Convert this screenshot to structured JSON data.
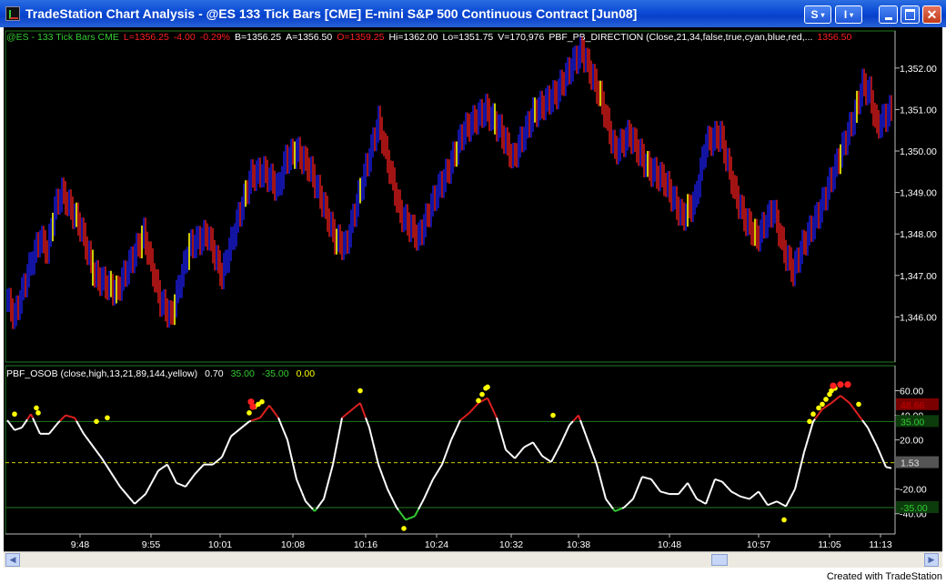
{
  "window": {
    "title": "TradeStation Chart Analysis - @ES  133 Tick Bars [CME] E-mini S&P 500 Continuous Contract [Jun08]",
    "buttons": {
      "style_label": "S",
      "insert_label": "I",
      "minimize": "minimize",
      "maximize": "maximize",
      "close": "close"
    }
  },
  "price_header": [
    {
      "text": "@ES - 133 Tick Bars  CME",
      "color": "#33cc33"
    },
    {
      "text": "L=1356.25",
      "color": "#ff2020"
    },
    {
      "text": "-4.00",
      "color": "#ff2020"
    },
    {
      "text": "-0.29%",
      "color": "#ff2020"
    },
    {
      "text": "B=1356.25",
      "color": "#ffffff"
    },
    {
      "text": "A=1356.50",
      "color": "#ffffff"
    },
    {
      "text": "O=1359.25",
      "color": "#ff2020"
    },
    {
      "text": "Hi=1362.00",
      "color": "#ffffff"
    },
    {
      "text": "Lo=1351.75",
      "color": "#ffffff"
    },
    {
      "text": "V=170,976",
      "color": "#ffffff"
    },
    {
      "text": "PBF_PB_DIRECTION (Close,21,34,false,true,cyan,blue,red,...",
      "color": "#ffffff"
    },
    {
      "text": "1356.50",
      "color": "#ff2020"
    }
  ],
  "price_axis": {
    "labels": [
      "1,352.00",
      "1,351.00",
      "1,350.00",
      "1,349.00",
      "1,348.00",
      "1,347.00",
      "1,346.00"
    ]
  },
  "indicator_header": [
    {
      "text": "PBF_OSOB (close,high,13,21,89,144,yellow)",
      "color": "#ffffff"
    },
    {
      "text": "0.70",
      "color": "#ffffff"
    },
    {
      "text": "35.00",
      "color": "#33cc33"
    },
    {
      "text": "-35.00",
      "color": "#33cc33"
    },
    {
      "text": "0.00",
      "color": "#ffff00"
    }
  ],
  "indicator_axis": {
    "labels": [
      "60.00",
      "40.00",
      "20.00",
      "-20.00",
      "-40.00"
    ]
  },
  "indicator_tags": [
    {
      "text": "48.66",
      "color": "#cc0000",
      "fill": "#7a0000"
    },
    {
      "text": "35.00",
      "color": "#33cc33",
      "fill": "#0c3c0c"
    },
    {
      "text": "1.53",
      "color": "#e0e0e0",
      "fill": "#555555"
    },
    {
      "text": "-35.00",
      "color": "#33cc33",
      "fill": "#0c3c0c"
    }
  ],
  "time_axis": {
    "labels": [
      "9:48",
      "9:55",
      "10:01",
      "10:08",
      "10:16",
      "10:24",
      "10:32",
      "10:38",
      "10:48",
      "10:57",
      "11:05",
      "11:13"
    ]
  },
  "scrollbar": {
    "left_arrow": "◀",
    "right_arrow": "▶"
  },
  "footer": {
    "credit": "Created with TradeStation"
  },
  "colors": {
    "background": "#000000",
    "up_bar": "#1a1acc",
    "down_bar": "#cc1a1a",
    "neutral_bar": "#ffff00",
    "oscillator": "#ffffff",
    "overbought_line": "#1f7a1f",
    "zero_line": "#ffff00"
  },
  "chart_data": {
    "type": "bar",
    "price_range": [
      1345.0,
      1352.5
    ],
    "indicator_range": [
      -55,
      70
    ],
    "overbought": 35.0,
    "oversold": -35.0,
    "last_oscillator": 1.53,
    "price_anchors": [
      [
        0,
        1346.4
      ],
      [
        4,
        1346.0
      ],
      [
        13,
        1347.3
      ],
      [
        18,
        1347.9
      ],
      [
        22,
        1347.6
      ],
      [
        26,
        1348.6
      ],
      [
        30,
        1349.0
      ],
      [
        40,
        1348.2
      ],
      [
        48,
        1347.0
      ],
      [
        60,
        1346.6
      ],
      [
        75,
        1348.0
      ],
      [
        84,
        1346.4
      ],
      [
        90,
        1346.0
      ],
      [
        100,
        1347.7
      ],
      [
        110,
        1348.0
      ],
      [
        118,
        1347.0
      ],
      [
        127,
        1348.4
      ],
      [
        134,
        1349.4
      ],
      [
        141,
        1349.5
      ],
      [
        149,
        1349.1
      ],
      [
        153,
        1349.8
      ],
      [
        159,
        1350.0
      ],
      [
        166,
        1349.6
      ],
      [
        173,
        1348.8
      ],
      [
        180,
        1347.9
      ],
      [
        186,
        1347.7
      ],
      [
        193,
        1348.9
      ],
      [
        204,
        1350.7
      ],
      [
        216,
        1348.5
      ],
      [
        226,
        1347.9
      ],
      [
        236,
        1349.0
      ],
      [
        242,
        1349.5
      ],
      [
        251,
        1350.5
      ],
      [
        263,
        1351.0
      ],
      [
        271,
        1350.5
      ],
      [
        278,
        1349.8
      ],
      [
        289,
        1350.9
      ],
      [
        302,
        1351.4
      ],
      [
        312,
        1352.2
      ],
      [
        316,
        1352.4
      ],
      [
        326,
        1351.3
      ],
      [
        334,
        1350.0
      ],
      [
        342,
        1350.4
      ],
      [
        352,
        1349.6
      ],
      [
        361,
        1349.3
      ],
      [
        371,
        1348.4
      ],
      [
        378,
        1348.8
      ],
      [
        384,
        1350.2
      ],
      [
        392,
        1350.4
      ],
      [
        400,
        1349.0
      ],
      [
        405,
        1348.4
      ],
      [
        412,
        1347.9
      ],
      [
        421,
        1348.6
      ],
      [
        427,
        1347.6
      ],
      [
        432,
        1347.1
      ],
      [
        437,
        1347.7
      ],
      [
        447,
        1348.6
      ],
      [
        456,
        1349.7
      ],
      [
        466,
        1350.9
      ],
      [
        470,
        1351.6
      ],
      [
        474,
        1351.4
      ],
      [
        478,
        1350.6
      ],
      [
        486,
        1351.0
      ]
    ],
    "yellow_bars": [
      25,
      38,
      47,
      57,
      60,
      74,
      92,
      100,
      131,
      158,
      181,
      194,
      247,
      268,
      290,
      326,
      352,
      374,
      411,
      458,
      467
    ],
    "oscillator_anchors": [
      [
        0,
        36
      ],
      [
        4,
        28
      ],
      [
        8,
        30
      ],
      [
        13,
        41
      ],
      [
        18,
        25
      ],
      [
        23,
        25
      ],
      [
        28,
        34
      ],
      [
        32,
        40
      ],
      [
        37,
        38
      ],
      [
        42,
        25
      ],
      [
        52,
        5
      ],
      [
        62,
        -18
      ],
      [
        70,
        -32
      ],
      [
        76,
        -24
      ],
      [
        83,
        -5
      ],
      [
        88,
        0
      ],
      [
        93,
        -15
      ],
      [
        98,
        -18
      ],
      [
        103,
        -8
      ],
      [
        108,
        0
      ],
      [
        113,
        0
      ],
      [
        118,
        6
      ],
      [
        123,
        23
      ],
      [
        133,
        35
      ],
      [
        139,
        38
      ],
      [
        144,
        48
      ],
      [
        149,
        38
      ],
      [
        154,
        20
      ],
      [
        159,
        -12
      ],
      [
        164,
        -30
      ],
      [
        169,
        -38
      ],
      [
        174,
        -28
      ],
      [
        179,
        0
      ],
      [
        184,
        38
      ],
      [
        194,
        50
      ],
      [
        199,
        30
      ],
      [
        204,
        0
      ],
      [
        209,
        -20
      ],
      [
        214,
        -35
      ],
      [
        219,
        -45
      ],
      [
        224,
        -42
      ],
      [
        229,
        -28
      ],
      [
        234,
        -12
      ],
      [
        239,
        0
      ],
      [
        244,
        20
      ],
      [
        249,
        36
      ],
      [
        254,
        42
      ],
      [
        259,
        50
      ],
      [
        264,
        54
      ],
      [
        269,
        38
      ],
      [
        274,
        12
      ],
      [
        279,
        5
      ],
      [
        284,
        14
      ],
      [
        289,
        18
      ],
      [
        294,
        7
      ],
      [
        299,
        2
      ],
      [
        304,
        16
      ],
      [
        309,
        32
      ],
      [
        314,
        40
      ],
      [
        319,
        20
      ],
      [
        324,
        0
      ],
      [
        329,
        -28
      ],
      [
        334,
        -38
      ],
      [
        339,
        -35
      ],
      [
        344,
        -28
      ],
      [
        349,
        -10
      ],
      [
        354,
        -12
      ],
      [
        359,
        -22
      ],
      [
        364,
        -24
      ],
      [
        369,
        -24
      ],
      [
        374,
        -15
      ],
      [
        379,
        -28
      ],
      [
        384,
        -32
      ],
      [
        389,
        -12
      ],
      [
        393,
        -14
      ],
      [
        398,
        -22
      ],
      [
        403,
        -26
      ],
      [
        408,
        -28
      ],
      [
        413,
        -22
      ],
      [
        418,
        -33
      ],
      [
        423,
        -30
      ],
      [
        428,
        -34
      ],
      [
        433,
        -20
      ],
      [
        438,
        10
      ],
      [
        443,
        35
      ],
      [
        448,
        45
      ],
      [
        453,
        50
      ],
      [
        458,
        56
      ],
      [
        463,
        50
      ],
      [
        468,
        40
      ],
      [
        473,
        30
      ],
      [
        478,
        15
      ],
      [
        483,
        -2
      ],
      [
        486,
        -3
      ]
    ],
    "osc_dot_bars": [
      [
        4,
        41,
        "#ffff00"
      ],
      [
        16,
        46,
        "#ffff00"
      ],
      [
        17,
        42,
        "#ffff00"
      ],
      [
        49,
        35,
        "#ffff00"
      ],
      [
        55,
        38,
        "#ffff00"
      ],
      [
        133,
        42,
        "#ffff00"
      ],
      [
        136,
        47,
        "#ffff00"
      ],
      [
        138,
        49,
        "#ffff00"
      ],
      [
        140,
        51,
        "#ffff00"
      ],
      [
        134,
        51,
        "#ff2020"
      ],
      [
        135,
        47,
        "#ff2020"
      ],
      [
        194,
        60,
        "#ffff00"
      ],
      [
        218,
        -52,
        "#ffff00"
      ],
      [
        259,
        52,
        "#ffff00"
      ],
      [
        261,
        57,
        "#ffff00"
      ],
      [
        263,
        62,
        "#ffff00"
      ],
      [
        264,
        63,
        "#ffff00"
      ],
      [
        300,
        40,
        "#ffff00"
      ],
      [
        427,
        -45,
        "#ffff00"
      ],
      [
        441,
        35,
        "#ffff00"
      ],
      [
        443,
        41,
        "#ffff00"
      ],
      [
        446,
        46,
        "#ffff00"
      ],
      [
        448,
        49,
        "#ffff00"
      ],
      [
        450,
        53,
        "#ffff00"
      ],
      [
        452,
        57,
        "#ffff00"
      ],
      [
        453,
        60,
        "#ffff00"
      ],
      [
        455,
        62,
        "#ffff00"
      ],
      [
        454,
        64,
        "#ff2020"
      ],
      [
        458,
        65,
        "#ff2020"
      ],
      [
        462,
        65,
        "#ff2020"
      ],
      [
        468,
        49,
        "#ffff00"
      ]
    ]
  }
}
